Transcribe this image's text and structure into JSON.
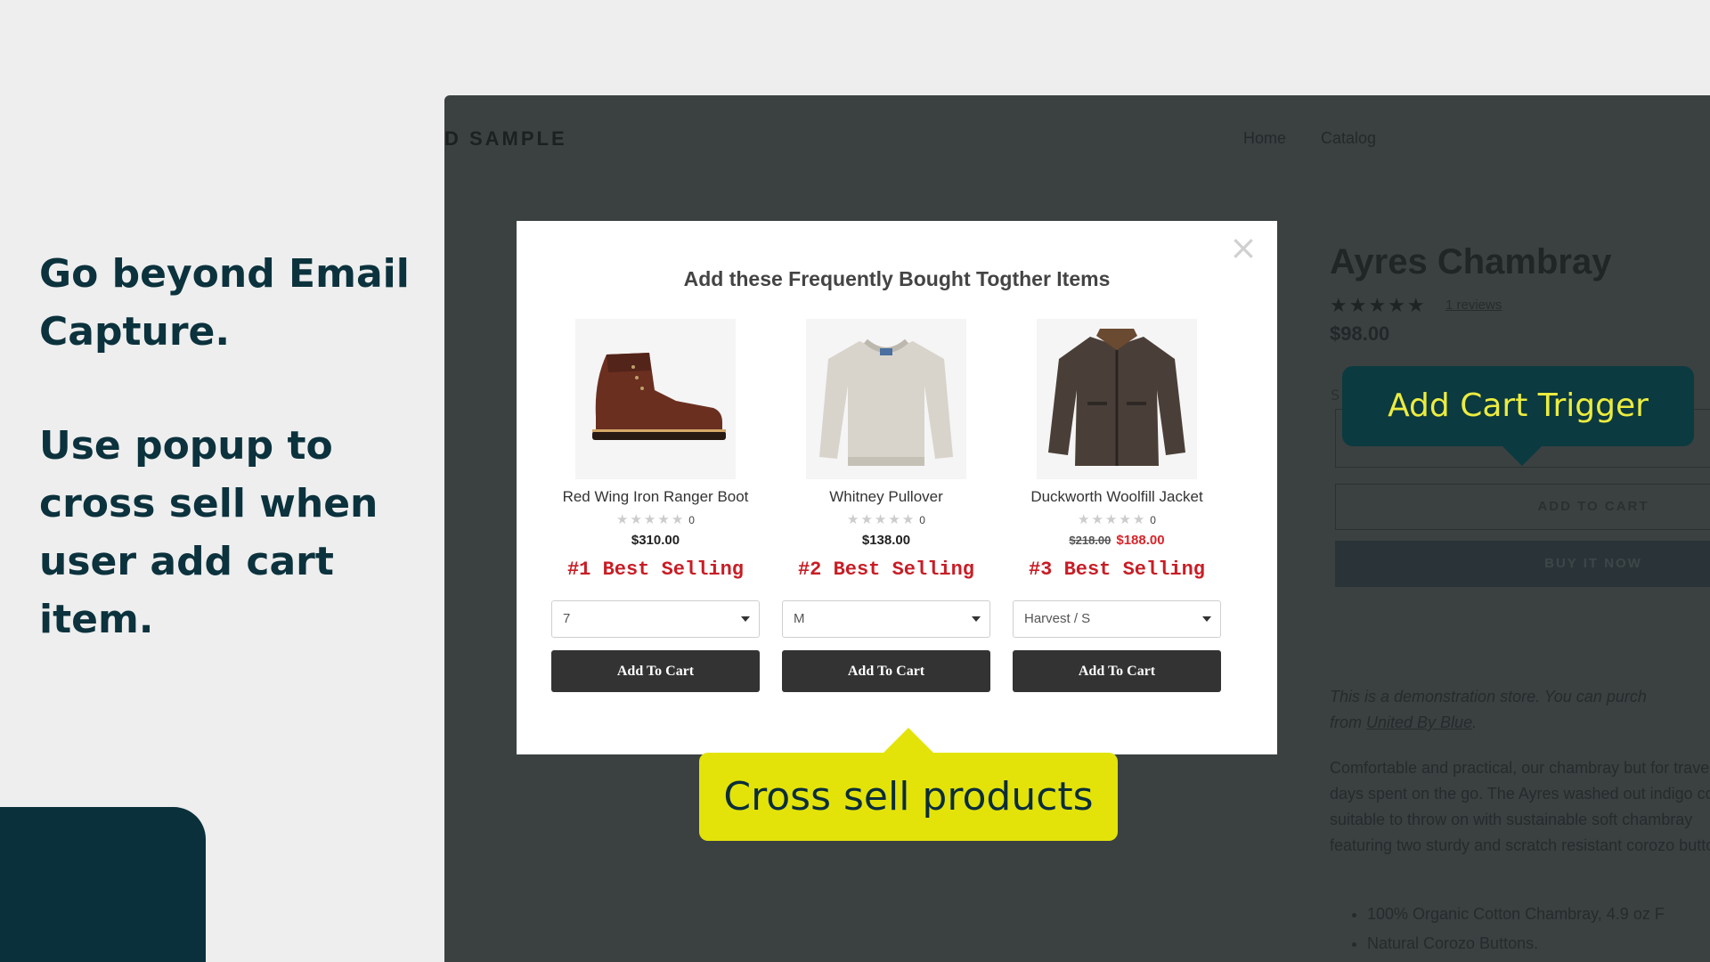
{
  "promo": {
    "line1": "Go beyond Email Capture.",
    "line2": "Use popup to cross sell when user add cart item."
  },
  "store": {
    "logo": "D SAMPLE",
    "nav": [
      "Home",
      "Catalog"
    ],
    "product": {
      "title": "Ayres Chambray",
      "stars": "★★★★★",
      "reviews": "1 reviews",
      "price": "$98.00",
      "size_label": "S",
      "add_to_cart": "ADD TO CART",
      "buy_now": "BUY IT NOW",
      "note_prefix": "This is a demonstration store. You can purch",
      "note_from": "from ",
      "note_link": "United By Blue",
      "note_suffix": ".",
      "description": "Comfortable and practical, our chambray but for travel or days spent on the go. The Ayres washed out indigo color suitable to throw on with sustainable soft chambray featuring two sturdy and scratch resistant corozo buttons.",
      "bullets": [
        "100% Organic Cotton Chambray, 4.9 oz F",
        "Natural Corozo Buttons."
      ]
    }
  },
  "modal": {
    "title": "Add these Frequently Bought Togther Items",
    "close": "×",
    "items": [
      {
        "name": "Red Wing Iron Ranger Boot",
        "stars": "★★★★★",
        "count": "0",
        "old_price": "",
        "price": "$310.00",
        "rank": "#1 Best Selling",
        "option": "7",
        "button": "Add To Cart",
        "image": "boot-image"
      },
      {
        "name": "Whitney Pullover",
        "stars": "★★★★★",
        "count": "0",
        "old_price": "",
        "price": "$138.00",
        "rank": "#2 Best Selling",
        "option": "M",
        "button": "Add To Cart",
        "image": "sweater-image"
      },
      {
        "name": "Duckworth Woolfill Jacket",
        "stars": "★★★★★",
        "count": "0",
        "old_price": "$218.00",
        "price": "$188.00",
        "rank": "#3 Best Selling",
        "option": "Harvest / S",
        "button": "Add To Cart",
        "image": "jacket-image"
      }
    ]
  },
  "callouts": {
    "cart_trigger": "Add Cart Trigger",
    "cross_sell": "Cross sell products"
  },
  "colors": {
    "accent_dark": "#0b3a40",
    "accent_yellow": "#e3e30a",
    "rank_red": "#c81d25"
  }
}
